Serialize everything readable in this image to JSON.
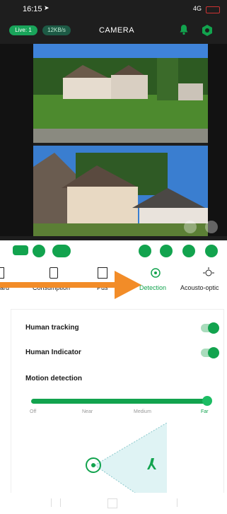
{
  "status_bar": {
    "time": "16:15",
    "network": "4G"
  },
  "camera_header": {
    "live_badge": "Live: 1",
    "bitrate_badge": "12KB/s",
    "title": "CAMERA"
  },
  "tabs": [
    {
      "label": "ard"
    },
    {
      "label": "Consumption"
    },
    {
      "label": "Pus"
    },
    {
      "label": "Detection"
    },
    {
      "label": "Acousto-optic"
    }
  ],
  "settings": {
    "human_tracking_label": "Human tracking",
    "human_indicator_label": "Human Indicator",
    "motion_detection_label": "Motion detection",
    "levels": [
      "Off",
      "Near",
      "Medium",
      "Far"
    ],
    "selected_level": "Far"
  },
  "colors": {
    "accent": "#12a34e",
    "arrow": "#f28c28"
  },
  "icons": {
    "location": "location-arrow-icon",
    "battery": "battery-icon",
    "bell": "bell-icon",
    "settings": "settings-icon"
  }
}
